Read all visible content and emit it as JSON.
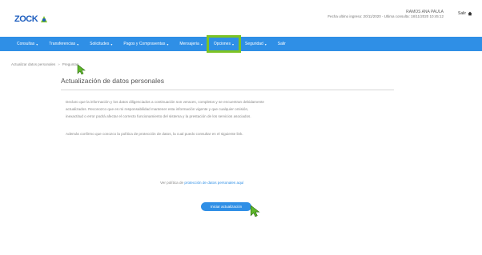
{
  "header": {
    "logo_text": "ZOCK",
    "user_name": "RAMOS ANA PAULA",
    "user_detail": "Fecha ultimo ingreso: 20/11/2020 - Ultima consulta: 18/11/2020 10:45:12",
    "exit_label": "Salir"
  },
  "nav": {
    "items": [
      {
        "label": "Consultas"
      },
      {
        "label": "Transferencias"
      },
      {
        "label": "Solicitudes"
      },
      {
        "label": "Pagos y Compraventas"
      },
      {
        "label": "Mensajeria"
      },
      {
        "label": "Opciones"
      },
      {
        "label": "Seguridad"
      },
      {
        "label": "Salir"
      }
    ],
    "active_index": 5
  },
  "breadcrumb": {
    "current": "Actualizar datos personales",
    "next": "Preguntas"
  },
  "main": {
    "title": "Actualización de datos personales",
    "para1_line1": "Declaro que la información y los datos diligenciados a continuación son veraces, completos y se encuentran debidamente",
    "para1_line2": "actualizados. Reconozco que es mi responsabilidad mantener esta información vigente y que cualquier omisión,",
    "para1_line3": "inexactitud o error podrá afectar el correcto funcionamiento del sistema y la prestación de los servicios asociados.",
    "para2": "Además confirmo que conozco la política de protección de datos, la cual puedo consultar en el siguiente link.",
    "policy_prefix": "Ver política de ",
    "policy_link": "protección de datos personales aquí",
    "confirm_button": "Iniciar actualización"
  },
  "colors": {
    "nav_bg": "#2f8fe6",
    "highlight": "#7cc323",
    "cursor": "#5fb82a"
  }
}
